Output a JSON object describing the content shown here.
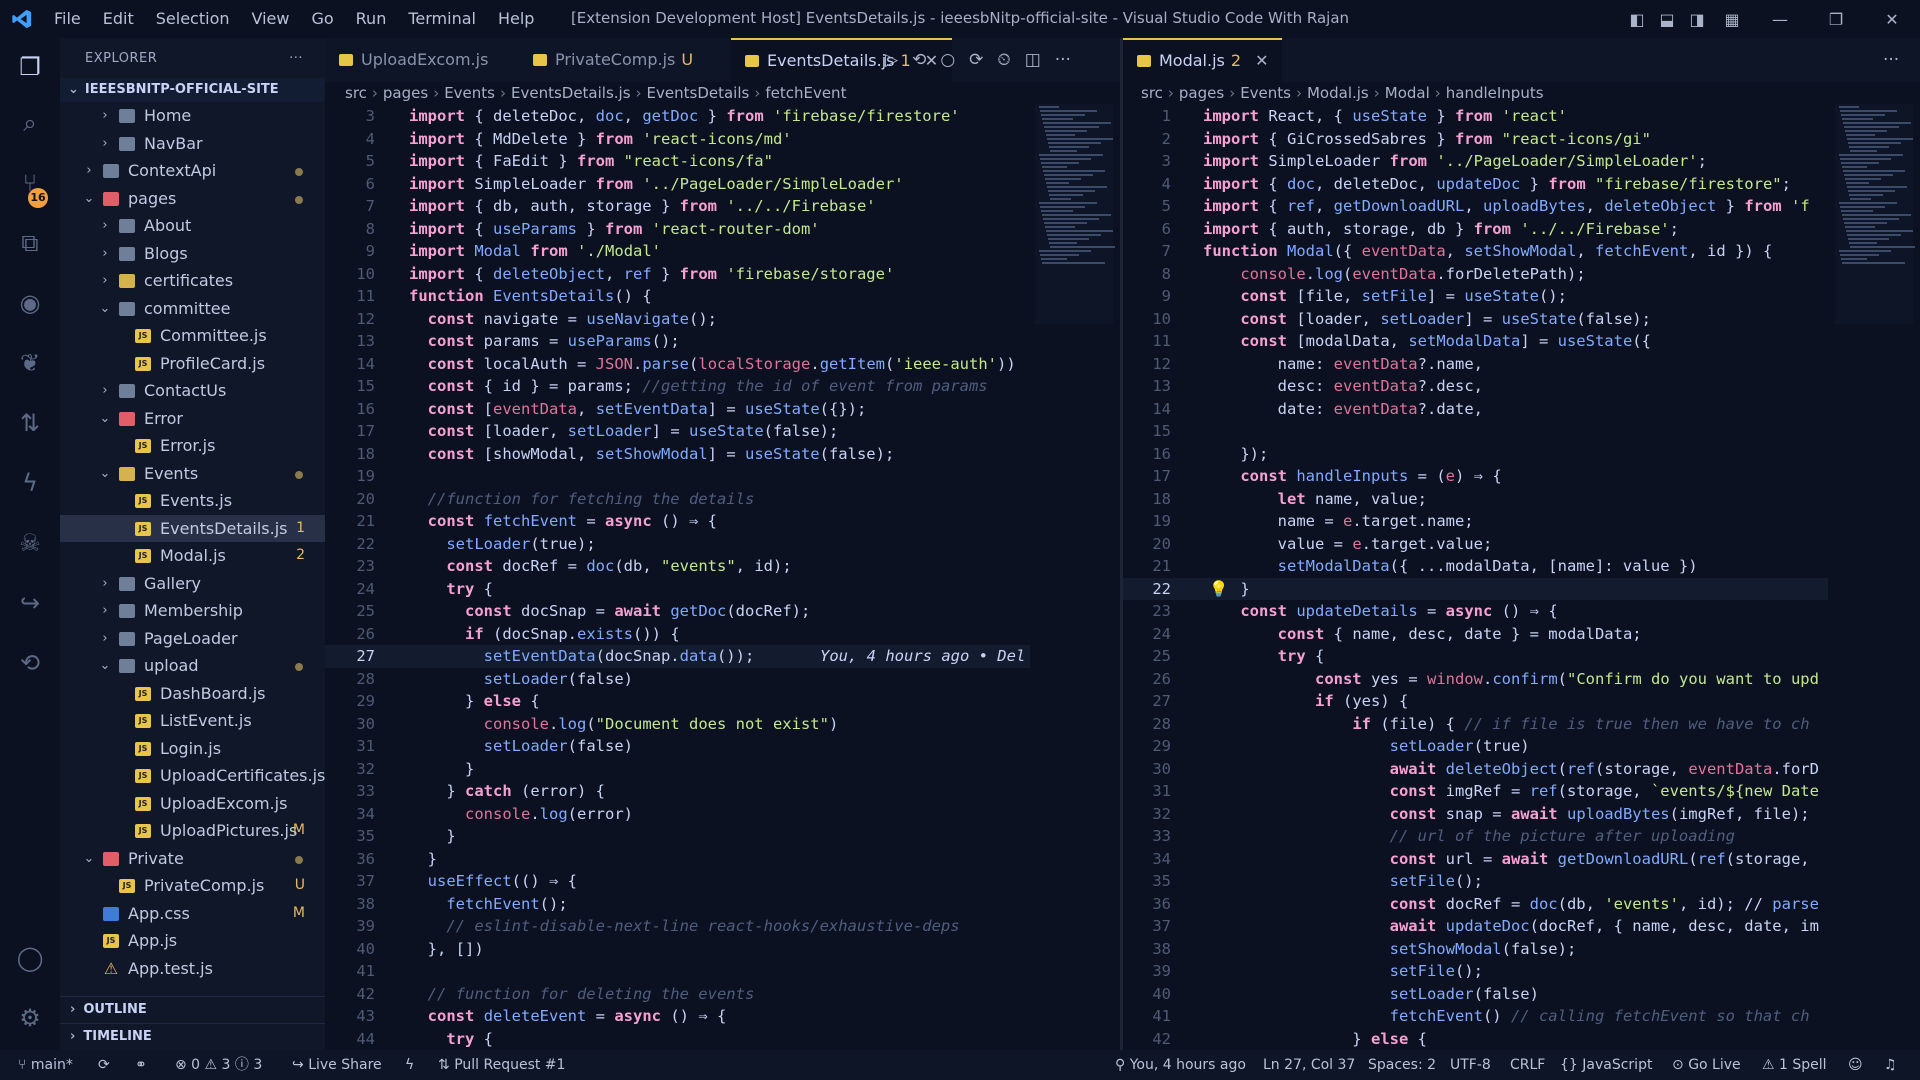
{
  "titlebar": {
    "menu": [
      "File",
      "Edit",
      "Selection",
      "View",
      "Go",
      "Run",
      "Terminal",
      "Help"
    ],
    "title": "[Extension Development Host] EventsDetails.js - ieeesbNitp-official-site - Visual Studio Code With Rajan"
  },
  "activity_bar": {
    "icons": [
      "files-icon",
      "search-icon",
      "source-control-icon",
      "extensions-icon",
      "github-icon",
      "leaf-icon",
      "pull-request-icon",
      "lightning-icon",
      "alien-icon",
      "live-share-icon",
      "history-icon",
      "account-icon",
      "settings-icon"
    ],
    "scm_badge": "16"
  },
  "explorer": {
    "title": "EXPLORER",
    "root": "IEEESBNITP-OFFICIAL-SITE",
    "outline": "OUTLINE",
    "timeline": "TIMELINE",
    "tree": [
      {
        "label": "Home",
        "depth": 1,
        "type": "folder",
        "open": false
      },
      {
        "label": "NavBar",
        "depth": 1,
        "type": "folder",
        "open": false
      },
      {
        "label": "ContextApi",
        "depth": 0,
        "type": "folder",
        "open": false,
        "dot": true
      },
      {
        "label": "pages",
        "depth": 0,
        "type": "folder-red",
        "open": true,
        "dot": true
      },
      {
        "label": "About",
        "depth": 1,
        "type": "folder",
        "open": false
      },
      {
        "label": "Blogs",
        "depth": 1,
        "type": "folder",
        "open": false
      },
      {
        "label": "certificates",
        "depth": 1,
        "type": "folder-yel",
        "open": false
      },
      {
        "label": "committee",
        "depth": 1,
        "type": "folder",
        "open": true
      },
      {
        "label": "Committee.js",
        "depth": 2,
        "type": "js"
      },
      {
        "label": "ProfileCard.js",
        "depth": 2,
        "type": "js"
      },
      {
        "label": "ContactUs",
        "depth": 1,
        "type": "folder",
        "open": false
      },
      {
        "label": "Error",
        "depth": 1,
        "type": "folder-red",
        "open": true
      },
      {
        "label": "Error.js",
        "depth": 2,
        "type": "js"
      },
      {
        "label": "Events",
        "depth": 1,
        "type": "folder-yel",
        "open": true,
        "dot": true
      },
      {
        "label": "Events.js",
        "depth": 2,
        "type": "js"
      },
      {
        "label": "EventsDetails.js",
        "depth": 2,
        "type": "js",
        "status": "1",
        "selected": true
      },
      {
        "label": "Modal.js",
        "depth": 2,
        "type": "js",
        "status": "2"
      },
      {
        "label": "Gallery",
        "depth": 1,
        "type": "folder",
        "open": false
      },
      {
        "label": "Membership",
        "depth": 1,
        "type": "folder",
        "open": false
      },
      {
        "label": "PageLoader",
        "depth": 1,
        "type": "folder",
        "open": false
      },
      {
        "label": "upload",
        "depth": 1,
        "type": "folder",
        "open": true,
        "dot": true
      },
      {
        "label": "DashBoard.js",
        "depth": 2,
        "type": "js"
      },
      {
        "label": "ListEvent.js",
        "depth": 2,
        "type": "js"
      },
      {
        "label": "Login.js",
        "depth": 2,
        "type": "js"
      },
      {
        "label": "UploadCertificates.js",
        "depth": 2,
        "type": "js"
      },
      {
        "label": "UploadExcom.js",
        "depth": 2,
        "type": "js"
      },
      {
        "label": "UploadPictures.js",
        "depth": 2,
        "type": "js",
        "status": "M"
      },
      {
        "label": "Private",
        "depth": 0,
        "type": "folder-red",
        "open": true,
        "dot": true
      },
      {
        "label": "PrivateComp.js",
        "depth": 1,
        "type": "js",
        "status": "U"
      },
      {
        "label": "App.css",
        "depth": 0,
        "type": "css",
        "status": "M"
      },
      {
        "label": "App.js",
        "depth": 0,
        "type": "js"
      },
      {
        "label": "App.test.js",
        "depth": 0,
        "type": "test"
      }
    ]
  },
  "left_editor": {
    "tabs": [
      {
        "label": "UploadExcom.js",
        "badge": "",
        "active": false
      },
      {
        "label": "PrivateComp.js",
        "badge": "U",
        "active": false
      },
      {
        "label": "EventsDetails.js",
        "badge": "1",
        "active": true
      }
    ],
    "breadcrumbs": [
      "src",
      "pages",
      "Events",
      "EventsDetails.js",
      "EventsDetails",
      "fetchEvent"
    ],
    "current_line": 27,
    "lines": [
      {
        "n": "3",
        "t": "import { deleteDoc, doc, getDoc } from 'firebase/firestore'"
      },
      {
        "n": "4",
        "t": "import { MdDelete } from 'react-icons/md'"
      },
      {
        "n": "5",
        "t": "import { FaEdit } from \"react-icons/fa\""
      },
      {
        "n": "6",
        "t": "import SimpleLoader from '../PageLoader/SimpleLoader'"
      },
      {
        "n": "7",
        "t": "import { db, auth, storage } from '../../Firebase'"
      },
      {
        "n": "8",
        "t": "import { useParams } from 'react-router-dom'"
      },
      {
        "n": "9",
        "t": "import Modal from './Modal'"
      },
      {
        "n": "10",
        "t": "import { deleteObject, ref } from 'firebase/storage'"
      },
      {
        "n": "11",
        "t": "function EventsDetails() {"
      },
      {
        "n": "12",
        "t": "  const navigate = useNavigate();"
      },
      {
        "n": "13",
        "t": "  const params = useParams();"
      },
      {
        "n": "14",
        "t": "  const localAuth = JSON.parse(localStorage.getItem('ieee-auth'))"
      },
      {
        "n": "15",
        "t": "  const { id } = params; //getting the id of event from params"
      },
      {
        "n": "16",
        "t": "  const [eventData, setEventData] = useState({});"
      },
      {
        "n": "17",
        "t": "  const [loader, setLoader] = useState(false);"
      },
      {
        "n": "18",
        "t": "  const [showModal, setShowModal] = useState(false);"
      },
      {
        "n": "19",
        "t": ""
      },
      {
        "n": "20",
        "t": "  //function for fetching the details"
      },
      {
        "n": "21",
        "t": "  const fetchEvent = async () ⇒ {"
      },
      {
        "n": "22",
        "t": "    setLoader(true);"
      },
      {
        "n": "23",
        "t": "    const docRef = doc(db, \"events\", id);"
      },
      {
        "n": "24",
        "t": "    try {"
      },
      {
        "n": "25",
        "t": "      const docSnap = await getDoc(docRef);"
      },
      {
        "n": "26",
        "t": "      if (docSnap.exists()) {"
      },
      {
        "n": "27",
        "t": "        setEventData(docSnap.data());",
        "blame": "You, 4 hours ago • Del"
      },
      {
        "n": "28",
        "t": "        setLoader(false)"
      },
      {
        "n": "29",
        "t": "      } else {"
      },
      {
        "n": "30",
        "t": "        console.log(\"Document does not exist\")"
      },
      {
        "n": "31",
        "t": "        setLoader(false)"
      },
      {
        "n": "32",
        "t": "      }"
      },
      {
        "n": "33",
        "t": "    } catch (error) {"
      },
      {
        "n": "34",
        "t": "      console.log(error)"
      },
      {
        "n": "35",
        "t": "    }"
      },
      {
        "n": "36",
        "t": "  }"
      },
      {
        "n": "37",
        "t": "  useEffect(() ⇒ {"
      },
      {
        "n": "38",
        "t": "    fetchEvent();"
      },
      {
        "n": "39",
        "t": "    // eslint-disable-next-line react-hooks/exhaustive-deps"
      },
      {
        "n": "40",
        "t": "  }, [])"
      },
      {
        "n": "41",
        "t": ""
      },
      {
        "n": "42",
        "t": "  // function for deleting the events"
      },
      {
        "n": "43",
        "t": "  const deleteEvent = async () ⇒ {"
      },
      {
        "n": "44",
        "t": "    try {"
      }
    ]
  },
  "right_editor": {
    "tabs": [
      {
        "label": "Modal.js",
        "badge": "2",
        "active": true
      }
    ],
    "breadcrumbs": [
      "src",
      "pages",
      "Events",
      "Modal.js",
      "Modal",
      "handleInputs"
    ],
    "current_line": 22,
    "lines": [
      {
        "n": "1",
        "t": "import React, { useState } from 'react'"
      },
      {
        "n": "2",
        "t": "import { GiCrossedSabres } from \"react-icons/gi\""
      },
      {
        "n": "3",
        "t": "import SimpleLoader from '../PageLoader/SimpleLoader';"
      },
      {
        "n": "4",
        "t": "import { doc, deleteDoc, updateDoc } from \"firebase/firestore\";"
      },
      {
        "n": "5",
        "t": "import { ref, getDownloadURL, uploadBytes, deleteObject } from 'f"
      },
      {
        "n": "6",
        "t": "import { auth, storage, db } from '../../Firebase';"
      },
      {
        "n": "7",
        "t": "function Modal({ eventData, setShowModal, fetchEvent, id }) {"
      },
      {
        "n": "8",
        "t": "    console.log(eventData.forDeletePath);"
      },
      {
        "n": "9",
        "t": "    const [file, setFile] = useState();"
      },
      {
        "n": "10",
        "t": "    const [loader, setLoader] = useState(false);"
      },
      {
        "n": "11",
        "t": "    const [modalData, setModalData] = useState({"
      },
      {
        "n": "12",
        "t": "        name: eventData?.name,"
      },
      {
        "n": "13",
        "t": "        desc: eventData?.desc,"
      },
      {
        "n": "14",
        "t": "        date: eventData?.date,"
      },
      {
        "n": "15",
        "t": ""
      },
      {
        "n": "16",
        "t": "    });"
      },
      {
        "n": "17",
        "t": "    const handleInputs = (e) ⇒ {"
      },
      {
        "n": "18",
        "t": "        let name, value;"
      },
      {
        "n": "19",
        "t": "        name = e.target.name;"
      },
      {
        "n": "20",
        "t": "        value = e.target.value;"
      },
      {
        "n": "21",
        "t": "        setModalData({ ...modalData, [name]: value })"
      },
      {
        "n": "22",
        "t": "    }"
      },
      {
        "n": "23",
        "t": "    const updateDetails = async () ⇒ {"
      },
      {
        "n": "24",
        "t": "        const { name, desc, date } = modalData;"
      },
      {
        "n": "25",
        "t": "        try {"
      },
      {
        "n": "26",
        "t": "            const yes = window.confirm(\"Confirm do you want to upd"
      },
      {
        "n": "27",
        "t": "            if (yes) {"
      },
      {
        "n": "28",
        "t": "                if (file) { // if file is true then we have to ch"
      },
      {
        "n": "29",
        "t": "                    setLoader(true)"
      },
      {
        "n": "30",
        "t": "                    await deleteObject(ref(storage, eventData.forD"
      },
      {
        "n": "31",
        "t": "                    const imgRef = ref(storage, `events/${new Date"
      },
      {
        "n": "32",
        "t": "                    const snap = await uploadBytes(imgRef, file);"
      },
      {
        "n": "33",
        "t": "                    // url of the picture after uploading"
      },
      {
        "n": "34",
        "t": "                    const url = await getDownloadURL(ref(storage,"
      },
      {
        "n": "35",
        "t": "                    setFile();"
      },
      {
        "n": "36",
        "t": "                    const docRef = doc(db, 'events', id); // parse"
      },
      {
        "n": "37",
        "t": "                    await updateDoc(docRef, { name, desc, date, im"
      },
      {
        "n": "38",
        "t": "                    setShowModal(false);"
      },
      {
        "n": "39",
        "t": "                    setFile();"
      },
      {
        "n": "40",
        "t": "                    setLoader(false)"
      },
      {
        "n": "41",
        "t": "                    fetchEvent() // calling fetchEvent so that ch"
      },
      {
        "n": "42",
        "t": "                } else {"
      }
    ]
  },
  "statusbar": {
    "branch": "main*",
    "problems": "⊗ 0  ⚠ 3  ⓘ 3",
    "live_share": "Live Share",
    "pull_request": "Pull Request #1",
    "blame": "You, 4 hours ago",
    "cursor": "Ln 27, Col 37",
    "spaces": "Spaces: 2",
    "encoding": "UTF-8",
    "eol": "CRLF",
    "language": "JavaScript",
    "go_live": "Go Live",
    "spell": "1 Spell"
  },
  "colors": {
    "accent": "#e7c547",
    "background": "#0b1120",
    "keyword": "#f7a1d2",
    "function": "#82aaff",
    "string": "#c3e88d"
  }
}
